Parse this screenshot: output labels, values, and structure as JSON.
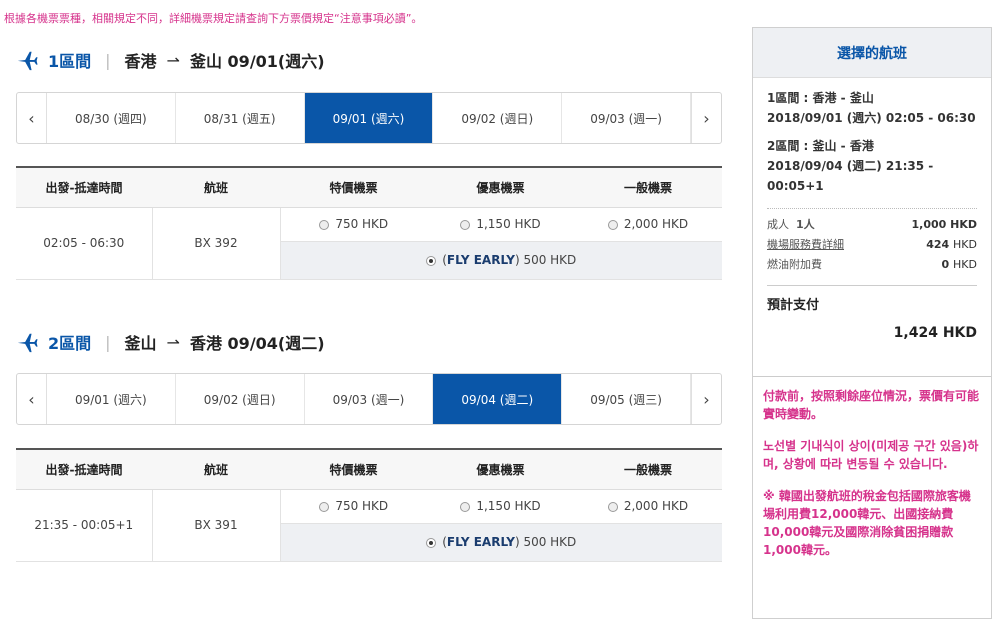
{
  "notice": "根據各機票票種，相關規定不同，詳細機票規定請查詢下方票價規定“注意事項必讀”。",
  "colors": {
    "accent": "#0a56a8",
    "notice_pink": "#d6338c"
  },
  "segments": [
    {
      "label": "1區間",
      "from": "香港",
      "to": "釜山",
      "date": "09/01(週六)",
      "dates": [
        "08/30 (週四)",
        "08/31 (週五)",
        "09/01 (週六)",
        "09/02 (週日)",
        "09/03 (週一)"
      ],
      "active_index": 2,
      "headers": [
        "出發-抵達時間",
        "航班",
        "特價機票",
        "優惠機票",
        "一般機票"
      ],
      "time": "02:05 - 06:30",
      "flight": "BX 392",
      "fares": [
        "750 HKD",
        "1,150 HKD",
        "2,000 HKD"
      ],
      "fly_early_label": "FLY EARLY",
      "fly_early_price": "500 HKD"
    },
    {
      "label": "2區間",
      "from": "釜山",
      "to": "香港",
      "date": "09/04(週二)",
      "dates": [
        "09/01 (週六)",
        "09/02 (週日)",
        "09/03 (週一)",
        "09/04 (週二)",
        "09/05 (週三)"
      ],
      "active_index": 3,
      "headers": [
        "出發-抵達時間",
        "航班",
        "特價機票",
        "優惠機票",
        "一般機票"
      ],
      "time": "21:35 - 00:05+1",
      "flight": "BX 391",
      "fares": [
        "750 HKD",
        "1,150 HKD",
        "2,000 HKD"
      ],
      "fly_early_label": "FLY EARLY",
      "fly_early_price": "500 HKD"
    }
  ],
  "sidebar": {
    "title": "選擇的航班",
    "seg1_title": "1區間 : 香港 - 釜山",
    "seg1_detail": "2018/09/01 (週六) 02:05 - 06:30",
    "seg2_title": "2區間 : 釜山 - 香港",
    "seg2_detail": "2018/09/04 (週二) 21:35 - 00:05+1",
    "adult_label": "成人",
    "adult_count": "1人",
    "adult_amount": "1,000",
    "airport_fee_label": "機場服務費詳細",
    "airport_fee_amount": "424",
    "fuel_label": "燃油附加費",
    "fuel_amount": "0",
    "currency": "HKD",
    "total_label": "預計支付",
    "total_amount": "1,424 HKD",
    "note1": "付款前，按照剩餘座位情況，票價有可能實時變動。",
    "note2": "노선별 기내식이 상이(미제공 구간 있음)하며, 상황에 따라 변동될 수 있습니다.",
    "note3": "※ 韓國出發航班的稅金包括國際旅客機場利用費12,000韓元、出國接納費10,000韓元及國際消除貧困捐贈款1,000韓元。"
  }
}
